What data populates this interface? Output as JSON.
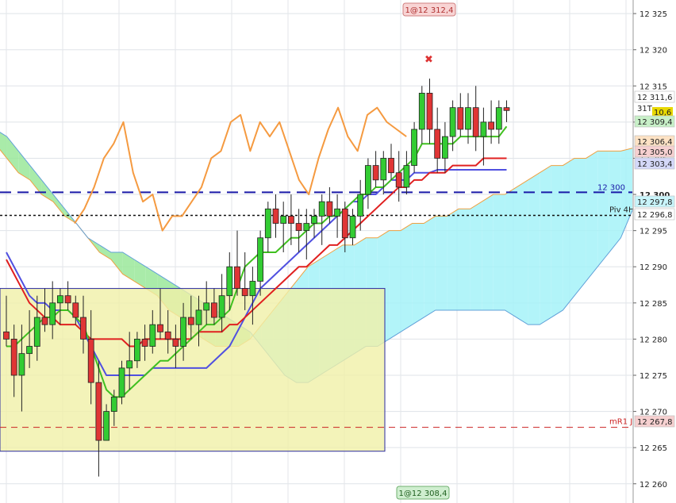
{
  "chart_data": {
    "type": "candlestick",
    "ylim": [
      12258,
      12326
    ],
    "y_ticks": [
      12260,
      12265,
      12270,
      12275,
      12280,
      12285,
      12290,
      12295,
      12300,
      12305,
      12310,
      12315,
      12320,
      12325
    ],
    "y_tick_labels": [
      "12 260",
      "12 265",
      "12 270",
      "12 275",
      "12 280",
      "12 285",
      "12 290",
      "12 295",
      "12 300",
      "12 305",
      "12 310",
      "12 315",
      "12 320",
      "12 325"
    ],
    "y_axis_labels": {
      "bold_300": "12 300"
    },
    "grid": true,
    "top_marker": {
      "text": "1@12 312,4",
      "color": "#f8d4d4",
      "text_color": "#b03030"
    },
    "bottom_marker": {
      "text": "1@12 308,4",
      "color": "#cfeecf",
      "text_color": "#206020"
    },
    "level_12300": {
      "text": "12 300",
      "value": 12300.3,
      "color": "#1a1aa8"
    },
    "pivot_4h": {
      "text": "Piv 4H",
      "value": 12297.1
    },
    "mr1": {
      "text": "mR1 J",
      "value": 12267.8,
      "color": "#cc2222"
    },
    "price_labels": [
      {
        "text": "12 311,6",
        "value": 12311.6,
        "bg": "#ffffff",
        "fg": "#000000"
      },
      {
        "text": "31T",
        "bg": "#ffffff",
        "fg": "#000000"
      },
      {
        "text": "10,6",
        "bg": "#e8d800",
        "fg": "#000000"
      },
      {
        "text": "12 309,4",
        "value": 12309.4,
        "bg": "#c8f0c8",
        "fg": "#208020"
      },
      {
        "text": "12 306,4",
        "value": 12306.4,
        "bg": "#fde2c4",
        "fg": "#c06010"
      },
      {
        "text": "12 305,0",
        "value": 12305.0,
        "bg": "#f6d0d0",
        "fg": "#b01010"
      },
      {
        "text": "12 303,4",
        "value": 12303.4,
        "bg": "#d4d8f8",
        "fg": "#1a1aa0"
      },
      {
        "text": "12 297,8",
        "value": 12297.8,
        "bg": "#c8f4fa",
        "fg": "#206080"
      },
      {
        "text": "12 296,8",
        "value": 12296.8,
        "bg": "#ffffff",
        "fg": "#000000"
      },
      {
        "text": "12 267,8",
        "value": 12267.8,
        "bg": "#f6d0d0",
        "fg": "#b01010"
      }
    ],
    "candles": [
      [
        12281,
        12286,
        12279,
        12280
      ],
      [
        12280,
        12282,
        12272,
        12275
      ],
      [
        12275,
        12282,
        12270,
        12278
      ],
      [
        12278,
        12284,
        12276,
        12279
      ],
      [
        12279,
        12286,
        12277,
        12283
      ],
      [
        12283,
        12287,
        12281,
        12282
      ],
      [
        12282,
        12288,
        12280,
        12285
      ],
      [
        12285,
        12287,
        12282,
        12286
      ],
      [
        12286,
        12288,
        12284,
        12285
      ],
      [
        12285,
        12286,
        12282,
        12283
      ],
      [
        12283,
        12286,
        12278,
        12280
      ],
      [
        12280,
        12284,
        12271,
        12274
      ],
      [
        12274,
        12277,
        12261,
        12266
      ],
      [
        12266,
        12271,
        12266,
        12270
      ],
      [
        12270,
        12273,
        12268,
        12272
      ],
      [
        12272,
        12277,
        12271,
        12276
      ],
      [
        12276,
        12281,
        12273,
        12277
      ],
      [
        12277,
        12281,
        12276,
        12280
      ],
      [
        12280,
        12282,
        12277,
        12279
      ],
      [
        12279,
        12284,
        12278,
        12282
      ],
      [
        12282,
        12287,
        12280,
        12281
      ],
      [
        12281,
        12284,
        12278,
        12280
      ],
      [
        12280,
        12282,
        12276,
        12279
      ],
      [
        12279,
        12285,
        12277,
        12283
      ],
      [
        12283,
        12286,
        12280,
        12282
      ],
      [
        12282,
        12286,
        12279,
        12284
      ],
      [
        12284,
        12288,
        12282,
        12285
      ],
      [
        12285,
        12287,
        12282,
        12283
      ],
      [
        12283,
        12289,
        12281,
        12286
      ],
      [
        12286,
        12292,
        12284,
        12290
      ],
      [
        12290,
        12295,
        12286,
        12287
      ],
      [
        12287,
        12292,
        12284,
        12286
      ],
      [
        12286,
        12290,
        12282,
        12288
      ],
      [
        12288,
        12295,
        12286,
        12294
      ],
      [
        12294,
        12299,
        12292,
        12298
      ],
      [
        12298,
        12300,
        12294,
        12296
      ],
      [
        12296,
        12299,
        12292,
        12297
      ],
      [
        12297,
        12300,
        12293,
        12296
      ],
      [
        12296,
        12298,
        12292,
        12295
      ],
      [
        12295,
        12298,
        12291,
        12296
      ],
      [
        12296,
        12298,
        12294,
        12297
      ],
      [
        12297,
        12300,
        12293,
        12299
      ],
      [
        12299,
        12301,
        12296,
        12297
      ],
      [
        12297,
        12300,
        12294,
        12298
      ],
      [
        12298,
        12299,
        12292,
        12294
      ],
      [
        12294,
        12298,
        12293,
        12297
      ],
      [
        12297,
        12302,
        12295,
        12300
      ],
      [
        12300,
        12305,
        12298,
        12304
      ],
      [
        12304,
        12306,
        12301,
        12302
      ],
      [
        12302,
        12306,
        12300,
        12305
      ],
      [
        12305,
        12307,
        12302,
        12303
      ],
      [
        12303,
        12306,
        12299,
        12301
      ],
      [
        12301,
        12306,
        12300,
        12304
      ],
      [
        12304,
        12310,
        12303,
        12309
      ],
      [
        12309,
        12315,
        12307,
        12314
      ],
      [
        12314,
        12316,
        12307,
        12309
      ],
      [
        12309,
        12312,
        12303,
        12305
      ],
      [
        12305,
        12310,
        12303,
        12308
      ],
      [
        12308,
        12313,
        12306,
        12312
      ],
      [
        12312,
        12314,
        12308,
        12309
      ],
      [
        12309,
        12314,
        12307,
        12312
      ],
      [
        12312,
        12315,
        12306,
        12308
      ],
      [
        12308,
        12312,
        12304,
        12310
      ],
      [
        12310,
        12313,
        12307,
        12309
      ],
      [
        12309,
        12313,
        12307,
        12312
      ],
      [
        12312,
        12313,
        12310,
        12311.6
      ]
    ],
    "tenkan": [
      12279,
      12279,
      12280,
      12281,
      12282,
      12283,
      12283,
      12284,
      12284,
      12283,
      12282,
      12279,
      12276,
      12273,
      12272,
      12272,
      12273,
      12274,
      12275,
      12276,
      12277,
      12277,
      12278,
      12279,
      12280,
      12281,
      12282,
      12282,
      12283,
      12284,
      12287,
      12290,
      12291,
      12292,
      12292,
      12292,
      12293,
      12294,
      12294,
      12295,
      12296,
      12296,
      12297,
      12297,
      12298,
      12299,
      12300,
      12300,
      12301,
      12301,
      12302,
      12303,
      12304,
      12305,
      12307,
      12307,
      12307,
      12307,
      12307,
      12308,
      12308,
      12308,
      12308,
      12308,
      12308,
      12309.4
    ],
    "kijun": [
      12292,
      12290,
      12288,
      12286,
      12285,
      12285,
      12284,
      12284,
      12284,
      12283,
      12281,
      12279,
      12277,
      12275,
      12275,
      12275,
      12275,
      12275,
      12275,
      12276,
      12276,
      12276,
      12276,
      12276,
      12276,
      12276,
      12276,
      12277,
      12278,
      12279,
      12281,
      12283,
      12285,
      12287,
      12288,
      12289,
      12290,
      12291,
      12292,
      12293,
      12294,
      12295,
      12296,
      12297,
      12298,
      12299,
      12299,
      12300,
      12300,
      12301,
      12302,
      12302,
      12302,
      12303,
      12303,
      12303,
      12303.4,
      12303.4,
      12303.4,
      12303.4,
      12303.4,
      12303.4,
      12303.4,
      12303.4,
      12303.4,
      12303.4
    ],
    "ma": [
      12291,
      12289,
      12287,
      12285,
      12284,
      12283,
      12283,
      12282,
      12282,
      12282,
      12281,
      12280,
      12280,
      12280,
      12280,
      12280,
      12279,
      12279,
      12280,
      12280,
      12280,
      12280,
      12280,
      12280,
      12280,
      12281,
      12281,
      12281,
      12281,
      12282,
      12282,
      12283,
      12284,
      12285,
      12286,
      12287,
      12288,
      12289,
      12290,
      12290,
      12291,
      12292,
      12293,
      12293,
      12294,
      12295,
      12296,
      12297,
      12298,
      12299,
      12300,
      12301,
      12301,
      12302,
      12302,
      12303,
      12303,
      12303,
      12304,
      12304,
      12304,
      12304,
      12305,
      12305,
      12305,
      12305.0
    ],
    "chikou": [
      12296,
      12298,
      12301,
      12305,
      12307,
      12310,
      12303,
      12299,
      12300,
      12295,
      12297,
      12297,
      12299,
      12301,
      12305,
      12306,
      12310,
      12311,
      12306,
      12310,
      12308,
      12310,
      12306,
      12302,
      12300,
      12305,
      12309,
      12312,
      12308,
      12306,
      12311,
      12312,
      12310,
      12309,
      12308
    ],
    "cloud_a": [
      12307,
      12305,
      12303,
      12302,
      12300,
      12299,
      12297,
      12296,
      12294,
      12292,
      12291,
      12289,
      12288,
      12287,
      12286,
      12284,
      12283,
      12281,
      12280,
      12279,
      12279,
      12279,
      12280,
      12282,
      12284,
      12286,
      12288,
      12290,
      12291,
      12292,
      12293,
      12293,
      12294,
      12294,
      12295,
      12295,
      12296,
      12296,
      12297,
      12297,
      12298,
      12298,
      12299,
      12300,
      12300,
      12301,
      12302,
      12303,
      12304,
      12304,
      12305,
      12305,
      12306,
      12306,
      12306,
      12306.4
    ],
    "cloud_b": [
      12309,
      12308,
      12306,
      12304,
      12302,
      12300,
      12298,
      12296,
      12294,
      12293,
      12292,
      12292,
      12291,
      12290,
      12289,
      12288,
      12287,
      12286,
      12285,
      12284,
      12283,
      12282,
      12281,
      12279,
      12277,
      12275,
      12274,
      12274,
      12275,
      12276,
      12277,
      12278,
      12279,
      12279,
      12280,
      12281,
      12282,
      12283,
      12284,
      12284,
      12284,
      12284,
      12284,
      12284,
      12284,
      12283,
      12282,
      12282,
      12283,
      12284,
      12286,
      12288,
      12290,
      12292,
      12294,
      12297.8
    ],
    "box": {
      "x0": 0,
      "x1": 485,
      "y_top": 12287,
      "y_bottom": 12264.5
    },
    "signal_x": "✖"
  }
}
